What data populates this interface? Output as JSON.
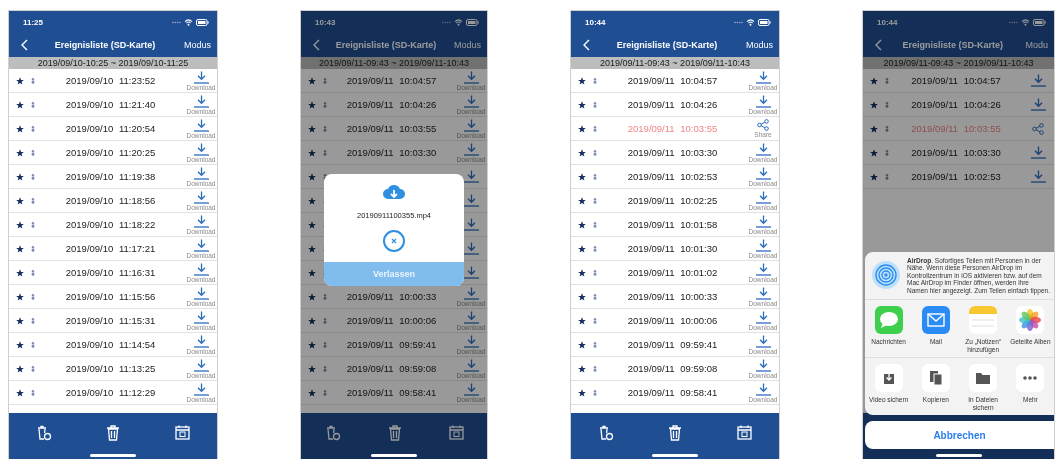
{
  "phones": [
    {
      "status_time": "11:25",
      "title": "Ereignisliste (SD-Karte)",
      "mode": "Modus",
      "range": "2019/09/10-10:25 ~ 2019/09/10-11:25",
      "dimmed": false,
      "rows": [
        {
          "time": "2019/09/10 11:23:52",
          "kind": "download",
          "action_label": "Download",
          "highlighted": false
        },
        {
          "time": "2019/09/10 11:21:40",
          "kind": "download",
          "action_label": "Download",
          "highlighted": false
        },
        {
          "time": "2019/09/10 11:20:54",
          "kind": "download",
          "action_label": "Download",
          "highlighted": false
        },
        {
          "time": "2019/09/10 11:20:25",
          "kind": "download",
          "action_label": "Download",
          "highlighted": false
        },
        {
          "time": "2019/09/10 11:19:38",
          "kind": "download",
          "action_label": "Download",
          "highlighted": false
        },
        {
          "time": "2019/09/10 11:18:56",
          "kind": "download",
          "action_label": "Download",
          "highlighted": false
        },
        {
          "time": "2019/09/10 11:18:22",
          "kind": "download",
          "action_label": "Download",
          "highlighted": false
        },
        {
          "time": "2019/09/10 11:17:21",
          "kind": "download",
          "action_label": "Download",
          "highlighted": false
        },
        {
          "time": "2019/09/10 11:16:31",
          "kind": "download",
          "action_label": "Download",
          "highlighted": false
        },
        {
          "time": "2019/09/10 11:15:56",
          "kind": "download",
          "action_label": "Download",
          "highlighted": false
        },
        {
          "time": "2019/09/10 11:15:31",
          "kind": "download",
          "action_label": "Download",
          "highlighted": false
        },
        {
          "time": "2019/09/10 11:14:54",
          "kind": "download",
          "action_label": "Download",
          "highlighted": false
        },
        {
          "time": "2019/09/10 11:13:25",
          "kind": "download",
          "action_label": "Download",
          "highlighted": false
        },
        {
          "time": "2019/09/10 11:12:29",
          "kind": "download",
          "action_label": "Download",
          "highlighted": false
        }
      ]
    },
    {
      "status_time": "10:43",
      "title": "Ereignisliste (SD-Karte)",
      "mode": "Modus",
      "range": "2019/09/11-09:43 ~ 2019/09/11-10:43",
      "dimmed": true,
      "rows": [
        {
          "time": "2019/09/11 10:04:57",
          "kind": "download",
          "action_label": "Download",
          "highlighted": false
        },
        {
          "time": "2019/09/11 10:04:26",
          "kind": "download",
          "action_label": "Download",
          "highlighted": false
        },
        {
          "time": "2019/09/11 10:03:55",
          "kind": "download",
          "action_label": "Download",
          "highlighted": false
        },
        {
          "time": "2019/09/11 10:03:30",
          "kind": "download",
          "action_label": "Download",
          "highlighted": false
        },
        {
          "kind": "download"
        },
        {
          "kind": "download"
        },
        {
          "kind": "download"
        },
        {
          "kind": "download"
        },
        {
          "kind": "download"
        },
        {
          "time": "2019/09/11 10:00:33",
          "kind": "download",
          "action_label": "Download",
          "highlighted": false
        },
        {
          "time": "2019/09/11 10:00:06",
          "kind": "download",
          "action_label": "Download",
          "highlighted": false
        },
        {
          "time": "2019/09/11 09:59:41",
          "kind": "download",
          "action_label": "Download",
          "highlighted": false
        },
        {
          "time": "2019/09/11 09:59:08",
          "kind": "download",
          "action_label": "Download",
          "highlighted": false
        },
        {
          "time": "2019/09/11 09:58:41",
          "kind": "download",
          "action_label": "Download",
          "highlighted": false
        }
      ],
      "overlay": {
        "kind": "download_dialog",
        "file": "20190911100355.mp4",
        "button": "Verlassen"
      }
    },
    {
      "status_time": "10:44",
      "title": "Ereignisliste (SD-Karte)",
      "mode": "Modus",
      "range": "2019/09/11-09:43 ~ 2019/09/11-10:43",
      "dimmed": false,
      "rows": [
        {
          "time": "2019/09/11 10:04:57",
          "kind": "download",
          "action_label": "Download",
          "highlighted": false
        },
        {
          "time": "2019/09/11 10:04:26",
          "kind": "download",
          "action_label": "Download",
          "highlighted": false
        },
        {
          "time": "2019/09/11 10:03:55",
          "kind": "share",
          "action_label": "Share",
          "highlighted": true
        },
        {
          "time": "2019/09/11 10:03:30",
          "kind": "download",
          "action_label": "Download",
          "highlighted": false
        },
        {
          "time": "2019/09/11 10:02:53",
          "kind": "download",
          "action_label": "Download",
          "highlighted": false
        },
        {
          "time": "2019/09/11 10:02:25",
          "kind": "download",
          "action_label": "Download",
          "highlighted": false
        },
        {
          "time": "2019/09/11 10:01:58",
          "kind": "download",
          "action_label": "Download",
          "highlighted": false
        },
        {
          "time": "2019/09/11 10:01:30",
          "kind": "download",
          "action_label": "Download",
          "highlighted": false
        },
        {
          "time": "2019/09/11 10:01:02",
          "kind": "download",
          "action_label": "Download",
          "highlighted": false
        },
        {
          "time": "2019/09/11 10:00:33",
          "kind": "download",
          "action_label": "Download",
          "highlighted": false
        },
        {
          "time": "2019/09/11 10:00:06",
          "kind": "download",
          "action_label": "Download",
          "highlighted": false
        },
        {
          "time": "2019/09/11 09:59:41",
          "kind": "download",
          "action_label": "Download",
          "highlighted": false
        },
        {
          "time": "2019/09/11 09:59:08",
          "kind": "download",
          "action_label": "Download",
          "highlighted": false
        },
        {
          "time": "2019/09/11 09:58:41",
          "kind": "download",
          "action_label": "Download",
          "highlighted": false
        }
      ]
    },
    {
      "status_time": "10:44",
      "title": "Ereignisliste (SD-Karte)",
      "mode": "Modu",
      "range": "2019/09/11-09:43 ~ 2019/09/11-10:43",
      "dimmed": true,
      "rows": [
        {
          "time": "2019/09/11 10:04:57",
          "kind": "download",
          "highlighted": false
        },
        {
          "time": "2019/09/11 10:04:26",
          "kind": "download",
          "highlighted": false
        },
        {
          "time": "2019/09/11 10:03:55",
          "kind": "share",
          "highlighted": true
        },
        {
          "time": "2019/09/11 10:03:30",
          "kind": "download",
          "highlighted": false
        },
        {
          "time": "2019/09/11 10:02:53",
          "kind": "download",
          "highlighted": false
        }
      ],
      "overlay": {
        "kind": "share_sheet",
        "airdrop_text": "**AirDrop**. Sofortiges Teilen mit Personen in der Nähe. Wenn diese Personen AirDrop im Kontrollzentrum in iOS aktivieren bzw. auf dem Mac AirDrop im Finder öffnen, werden ihre Namen hier angezeigt. Zum Teilen einfach tippen.",
        "apps": [
          {
            "kind": "messages",
            "label": "Nachrichten"
          },
          {
            "kind": "mail",
            "label": "Mail"
          },
          {
            "kind": "notes",
            "label": "Zu „Notizen“ hinzufügen"
          },
          {
            "kind": "photos",
            "label": "Geteilte Alben"
          }
        ],
        "actions": [
          {
            "kind": "save",
            "label": "Video sichern"
          },
          {
            "kind": "copy",
            "label": "Kopieren"
          },
          {
            "kind": "files",
            "label": "In Dateien sichern"
          },
          {
            "kind": "more",
            "label": "Mehr"
          }
        ],
        "cancel": "Abbrechen"
      }
    }
  ]
}
